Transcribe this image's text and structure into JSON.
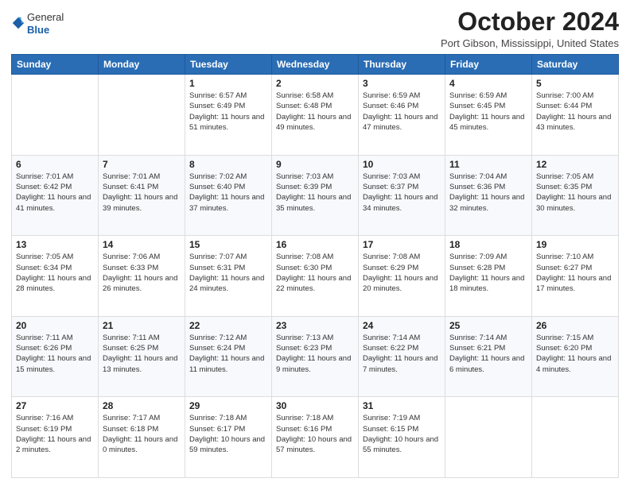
{
  "header": {
    "logo_general": "General",
    "logo_blue": "Blue",
    "month_title": "October 2024",
    "location": "Port Gibson, Mississippi, United States"
  },
  "days_of_week": [
    "Sunday",
    "Monday",
    "Tuesday",
    "Wednesday",
    "Thursday",
    "Friday",
    "Saturday"
  ],
  "weeks": [
    [
      {
        "day": "",
        "info": ""
      },
      {
        "day": "",
        "info": ""
      },
      {
        "day": "1",
        "info": "Sunrise: 6:57 AM\nSunset: 6:49 PM\nDaylight: 11 hours and 51 minutes."
      },
      {
        "day": "2",
        "info": "Sunrise: 6:58 AM\nSunset: 6:48 PM\nDaylight: 11 hours and 49 minutes."
      },
      {
        "day": "3",
        "info": "Sunrise: 6:59 AM\nSunset: 6:46 PM\nDaylight: 11 hours and 47 minutes."
      },
      {
        "day": "4",
        "info": "Sunrise: 6:59 AM\nSunset: 6:45 PM\nDaylight: 11 hours and 45 minutes."
      },
      {
        "day": "5",
        "info": "Sunrise: 7:00 AM\nSunset: 6:44 PM\nDaylight: 11 hours and 43 minutes."
      }
    ],
    [
      {
        "day": "6",
        "info": "Sunrise: 7:01 AM\nSunset: 6:42 PM\nDaylight: 11 hours and 41 minutes."
      },
      {
        "day": "7",
        "info": "Sunrise: 7:01 AM\nSunset: 6:41 PM\nDaylight: 11 hours and 39 minutes."
      },
      {
        "day": "8",
        "info": "Sunrise: 7:02 AM\nSunset: 6:40 PM\nDaylight: 11 hours and 37 minutes."
      },
      {
        "day": "9",
        "info": "Sunrise: 7:03 AM\nSunset: 6:39 PM\nDaylight: 11 hours and 35 minutes."
      },
      {
        "day": "10",
        "info": "Sunrise: 7:03 AM\nSunset: 6:37 PM\nDaylight: 11 hours and 34 minutes."
      },
      {
        "day": "11",
        "info": "Sunrise: 7:04 AM\nSunset: 6:36 PM\nDaylight: 11 hours and 32 minutes."
      },
      {
        "day": "12",
        "info": "Sunrise: 7:05 AM\nSunset: 6:35 PM\nDaylight: 11 hours and 30 minutes."
      }
    ],
    [
      {
        "day": "13",
        "info": "Sunrise: 7:05 AM\nSunset: 6:34 PM\nDaylight: 11 hours and 28 minutes."
      },
      {
        "day": "14",
        "info": "Sunrise: 7:06 AM\nSunset: 6:33 PM\nDaylight: 11 hours and 26 minutes."
      },
      {
        "day": "15",
        "info": "Sunrise: 7:07 AM\nSunset: 6:31 PM\nDaylight: 11 hours and 24 minutes."
      },
      {
        "day": "16",
        "info": "Sunrise: 7:08 AM\nSunset: 6:30 PM\nDaylight: 11 hours and 22 minutes."
      },
      {
        "day": "17",
        "info": "Sunrise: 7:08 AM\nSunset: 6:29 PM\nDaylight: 11 hours and 20 minutes."
      },
      {
        "day": "18",
        "info": "Sunrise: 7:09 AM\nSunset: 6:28 PM\nDaylight: 11 hours and 18 minutes."
      },
      {
        "day": "19",
        "info": "Sunrise: 7:10 AM\nSunset: 6:27 PM\nDaylight: 11 hours and 17 minutes."
      }
    ],
    [
      {
        "day": "20",
        "info": "Sunrise: 7:11 AM\nSunset: 6:26 PM\nDaylight: 11 hours and 15 minutes."
      },
      {
        "day": "21",
        "info": "Sunrise: 7:11 AM\nSunset: 6:25 PM\nDaylight: 11 hours and 13 minutes."
      },
      {
        "day": "22",
        "info": "Sunrise: 7:12 AM\nSunset: 6:24 PM\nDaylight: 11 hours and 11 minutes."
      },
      {
        "day": "23",
        "info": "Sunrise: 7:13 AM\nSunset: 6:23 PM\nDaylight: 11 hours and 9 minutes."
      },
      {
        "day": "24",
        "info": "Sunrise: 7:14 AM\nSunset: 6:22 PM\nDaylight: 11 hours and 7 minutes."
      },
      {
        "day": "25",
        "info": "Sunrise: 7:14 AM\nSunset: 6:21 PM\nDaylight: 11 hours and 6 minutes."
      },
      {
        "day": "26",
        "info": "Sunrise: 7:15 AM\nSunset: 6:20 PM\nDaylight: 11 hours and 4 minutes."
      }
    ],
    [
      {
        "day": "27",
        "info": "Sunrise: 7:16 AM\nSunset: 6:19 PM\nDaylight: 11 hours and 2 minutes."
      },
      {
        "day": "28",
        "info": "Sunrise: 7:17 AM\nSunset: 6:18 PM\nDaylight: 11 hours and 0 minutes."
      },
      {
        "day": "29",
        "info": "Sunrise: 7:18 AM\nSunset: 6:17 PM\nDaylight: 10 hours and 59 minutes."
      },
      {
        "day": "30",
        "info": "Sunrise: 7:18 AM\nSunset: 6:16 PM\nDaylight: 10 hours and 57 minutes."
      },
      {
        "day": "31",
        "info": "Sunrise: 7:19 AM\nSunset: 6:15 PM\nDaylight: 10 hours and 55 minutes."
      },
      {
        "day": "",
        "info": ""
      },
      {
        "day": "",
        "info": ""
      }
    ]
  ]
}
